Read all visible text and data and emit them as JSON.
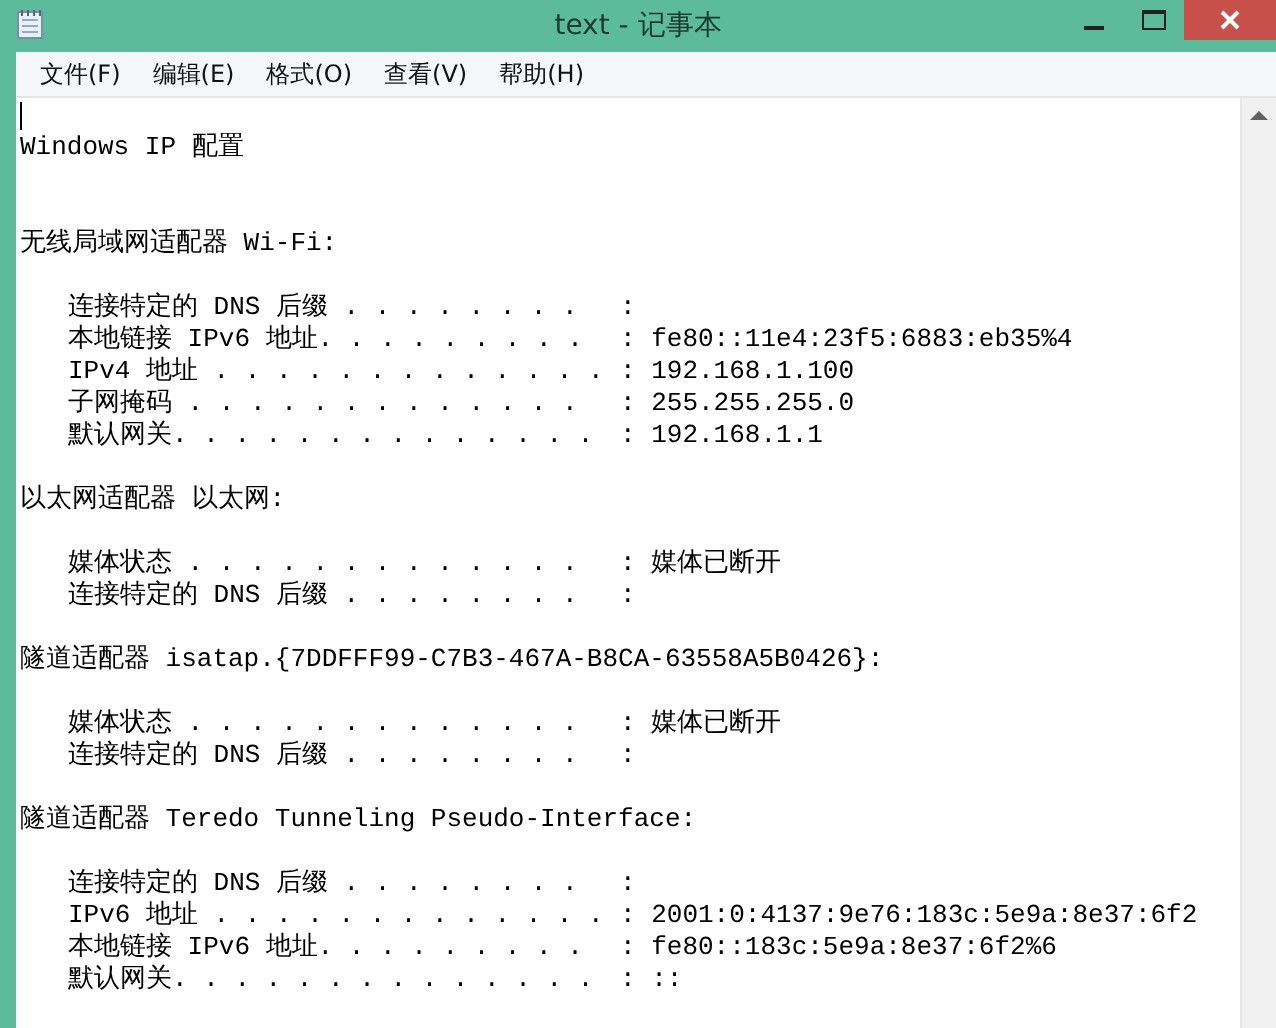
{
  "window": {
    "title": "text - 记事本"
  },
  "menu": [
    "文件(F)",
    "编辑(E)",
    "格式(O)",
    "查看(V)",
    "帮助(H)"
  ],
  "lines": [
    {
      "kind": "caret"
    },
    {
      "kind": "heading",
      "text": "Windows IP 配置"
    },
    {
      "kind": "blank"
    },
    {
      "kind": "blank"
    },
    {
      "kind": "heading",
      "text": "无线局域网适配器 Wi-Fi:"
    },
    {
      "kind": "blank"
    },
    {
      "kind": "field",
      "label": "连接特定的 DNS 后缀 . . . . . . . .",
      "value": ":"
    },
    {
      "kind": "field",
      "label": "本地链接 IPv6 地址. . . . . . . . .",
      "value": ": fe80::11e4:23f5:6883:eb35%4"
    },
    {
      "kind": "field",
      "label": "IPv4 地址 . . . . . . . . . . . . .",
      "value": ": 192.168.1.100"
    },
    {
      "kind": "field",
      "label": "子网掩码 . . . . . . . . . . . . .",
      "value": ": 255.255.255.0"
    },
    {
      "kind": "field",
      "label": "默认网关. . . . . . . . . . . . . .",
      "value": ": 192.168.1.1"
    },
    {
      "kind": "blank"
    },
    {
      "kind": "heading",
      "text": "以太网适配器 以太网:"
    },
    {
      "kind": "blank"
    },
    {
      "kind": "field",
      "label": "媒体状态 . . . . . . . . . . . . .",
      "value": ": 媒体已断开"
    },
    {
      "kind": "field",
      "label": "连接特定的 DNS 后缀 . . . . . . . .",
      "value": ":"
    },
    {
      "kind": "blank"
    },
    {
      "kind": "heading",
      "text": "隧道适配器 isatap.{7DDFFF99-C7B3-467A-B8CA-63558A5B0426}:"
    },
    {
      "kind": "blank"
    },
    {
      "kind": "field",
      "label": "媒体状态 . . . . . . . . . . . . .",
      "value": ": 媒体已断开"
    },
    {
      "kind": "field",
      "label": "连接特定的 DNS 后缀 . . . . . . . .",
      "value": ":"
    },
    {
      "kind": "blank"
    },
    {
      "kind": "heading",
      "text": "隧道适配器 Teredo Tunneling Pseudo-Interface:"
    },
    {
      "kind": "blank"
    },
    {
      "kind": "field",
      "label": "连接特定的 DNS 后缀 . . . . . . . .",
      "value": ":"
    },
    {
      "kind": "field",
      "label": "IPv6 地址 . . . . . . . . . . . . .",
      "value": ": 2001:0:4137:9e76:183c:5e9a:8e37:6f2"
    },
    {
      "kind": "field",
      "label": "本地链接 IPv6 地址. . . . . . . . .",
      "value": ": fe80::183c:5e9a:8e37:6f2%6"
    },
    {
      "kind": "field",
      "label": "默认网关. . . . . . . . . . . . . .",
      "value": ": ::"
    }
  ]
}
